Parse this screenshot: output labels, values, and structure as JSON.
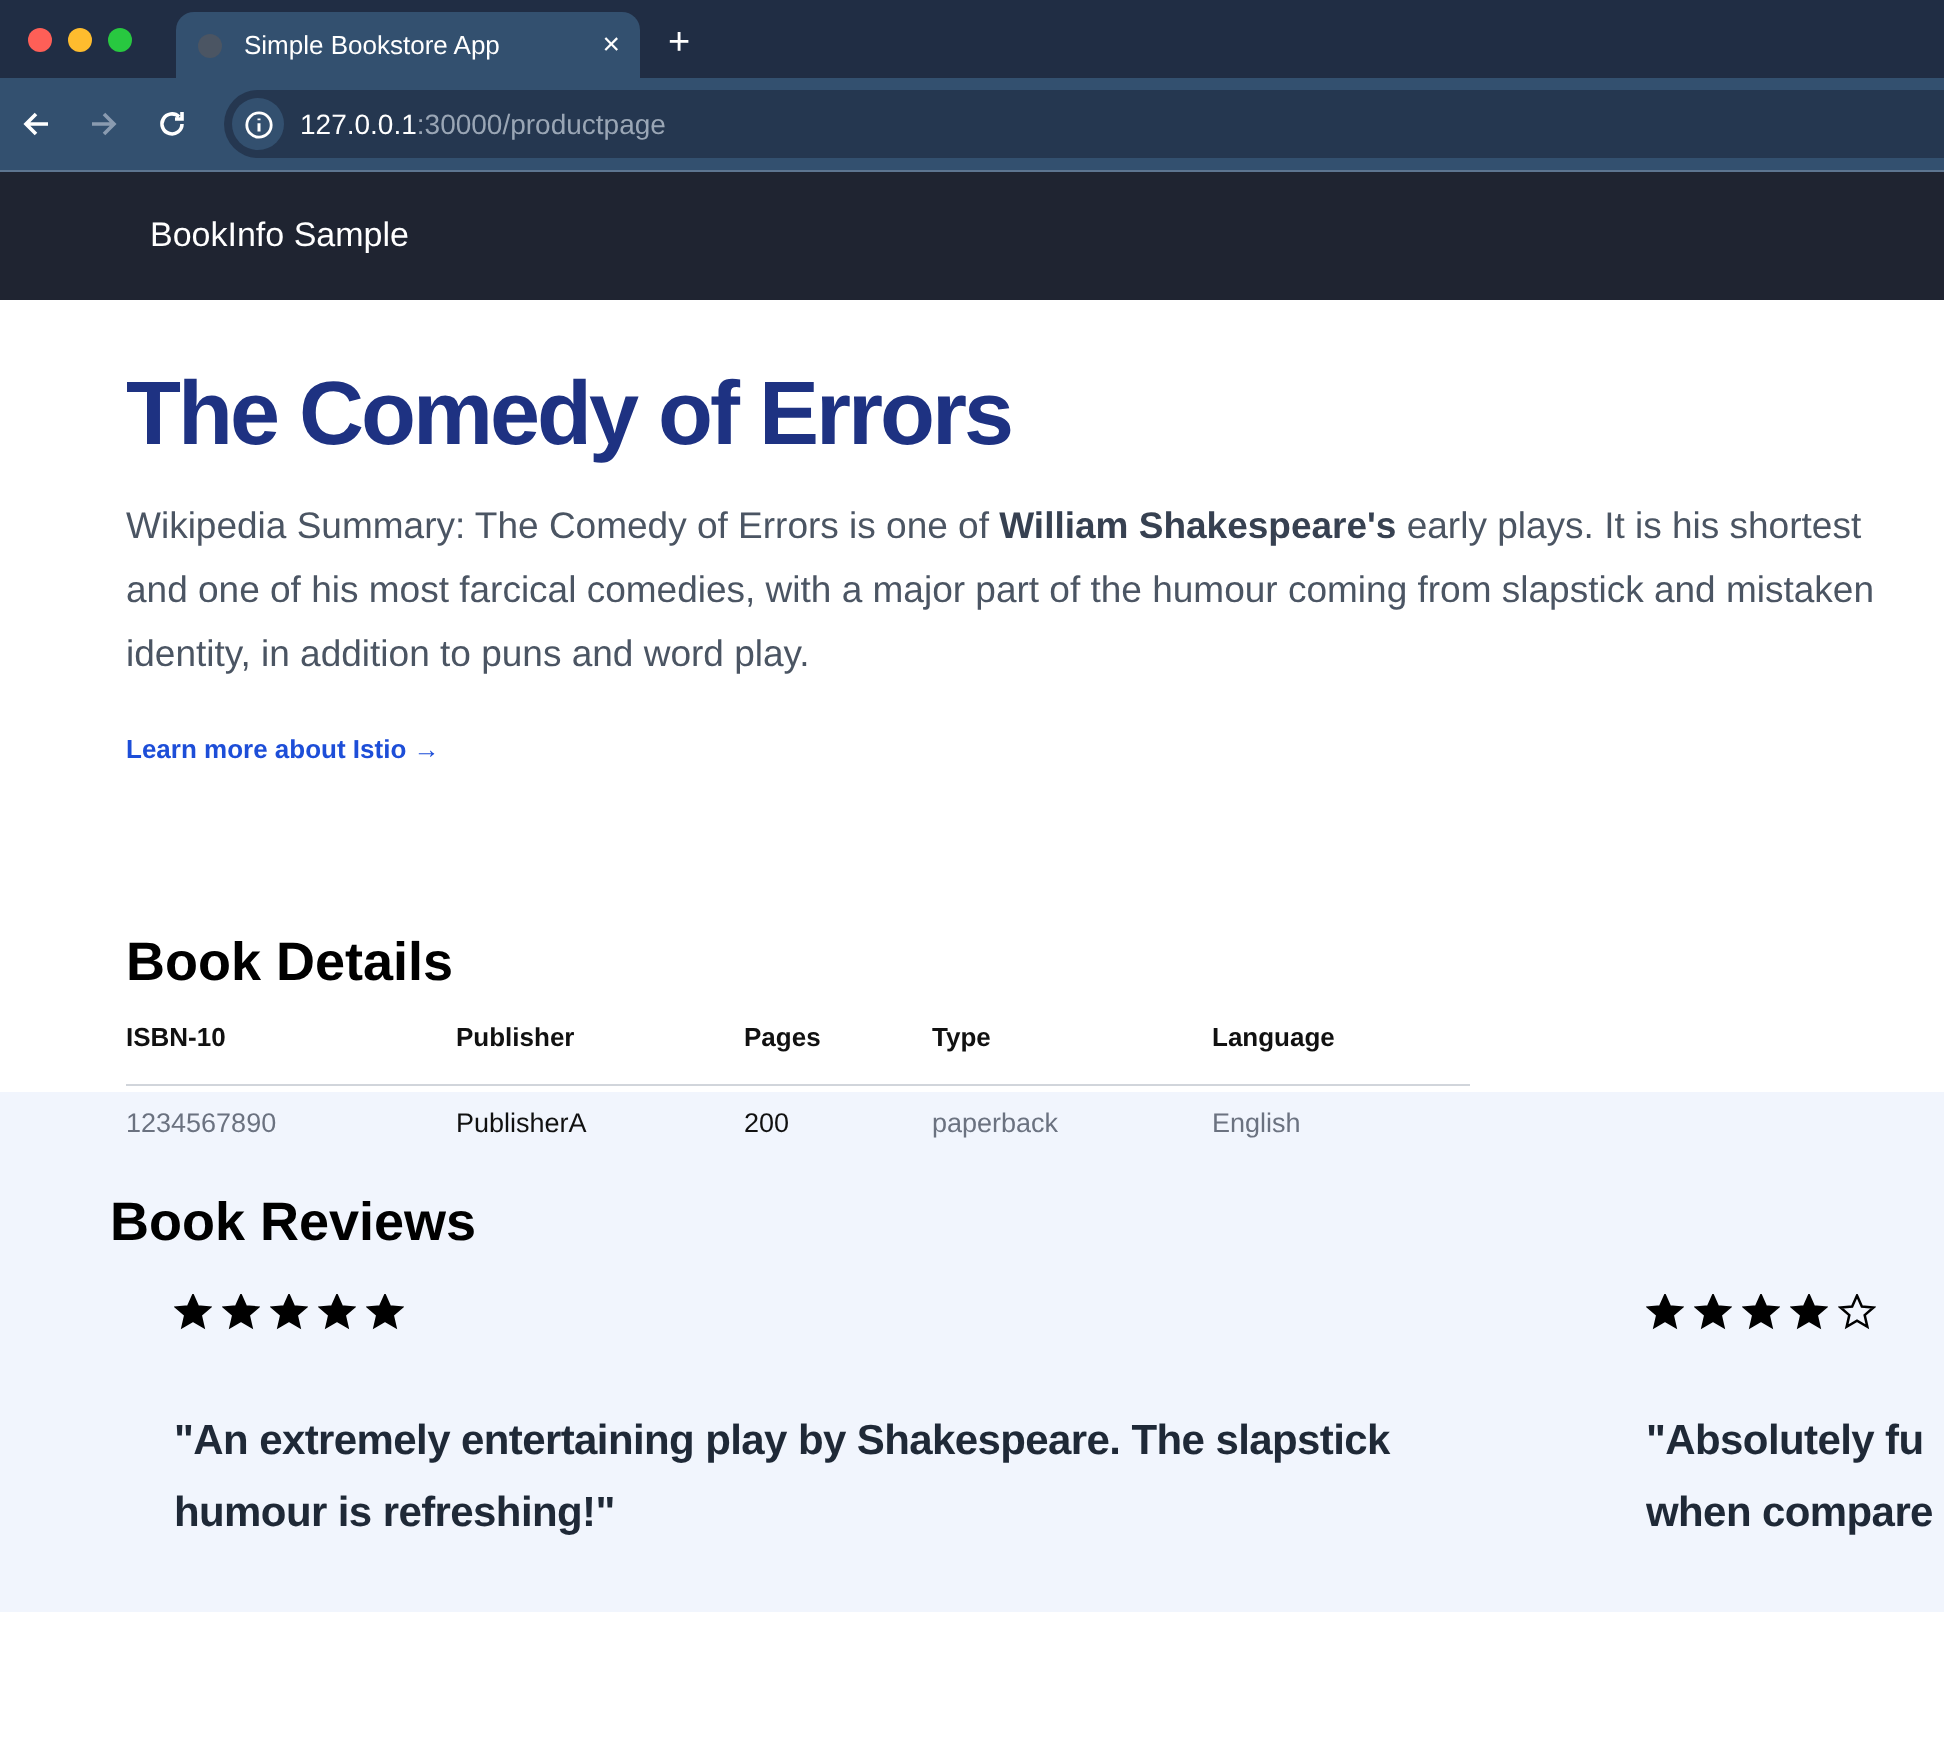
{
  "browser": {
    "tab": {
      "title": "Simple Bookstore App",
      "close": "×"
    },
    "new_tab": "+",
    "address": {
      "host": "127.0.0.1",
      "path": ":30000/productpage"
    }
  },
  "navbar": {
    "brand": "BookInfo Sample"
  },
  "product": {
    "title": "The Comedy of Errors",
    "summary": "Wikipedia Summary: The Comedy of Errors is one of **William Shakespeare's** early plays. It is his shortest and one of his most farcical comedies, with a major part of the humour coming from slapstick and mistaken identity, in addition to puns and word play.",
    "link": "Learn more about Istio →"
  },
  "details": {
    "title": "Book Details",
    "columns": [
      "ISBN-10",
      "Publisher",
      "Pages",
      "Type",
      "Language"
    ],
    "rows": [
      [
        "1234567890",
        "PublisherA",
        "200",
        "paperback",
        "English"
      ]
    ]
  },
  "reviews": {
    "title": "Book Reviews",
    "items": [
      {
        "stars": 5,
        "text": "\"An extremely entertaining play by Shakespeare. The slapstick humour is refreshing!\""
      },
      {
        "stars": 4,
        "text": "\"Absolutely fu when compare"
      }
    ]
  }
}
